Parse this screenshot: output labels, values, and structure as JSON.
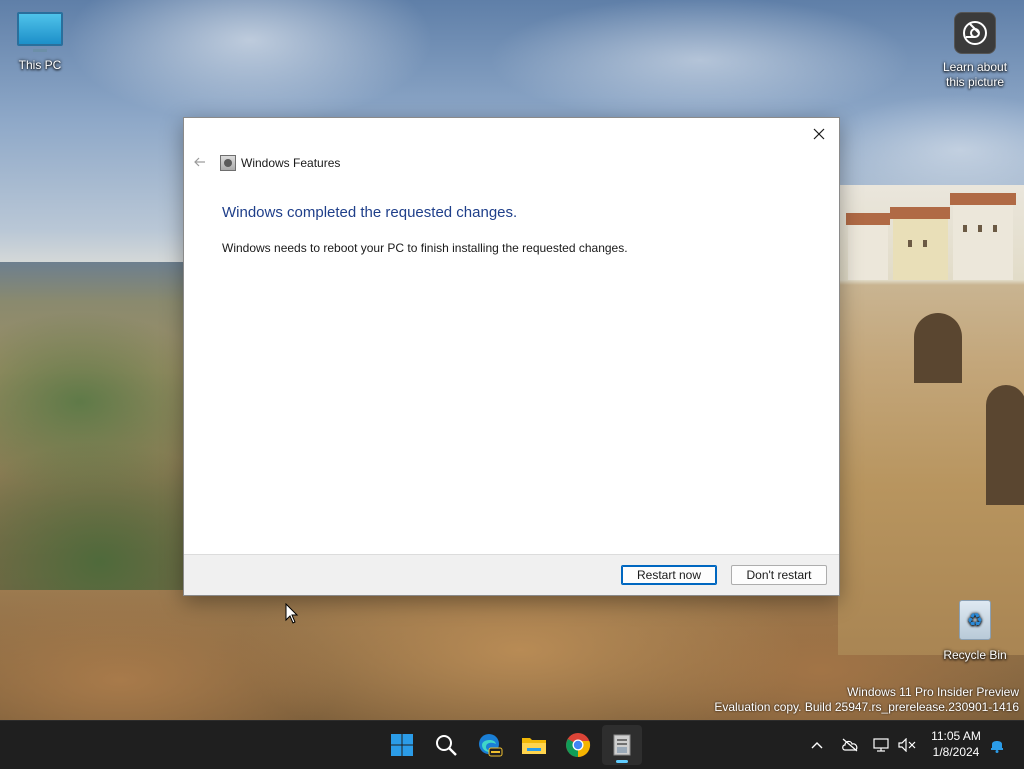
{
  "desktop": {
    "icons": {
      "this_pc": "This PC",
      "learn_line1": "Learn about",
      "learn_line2": "this picture",
      "recycle_bin": "Recycle Bin"
    },
    "watermark": {
      "line1": "Windows 11 Pro Insider Preview",
      "line2": "Evaluation copy. Build 25947.rs_prerelease.230901-1416"
    }
  },
  "dialog": {
    "title": "Windows Features",
    "heading": "Windows completed the requested changes.",
    "message": "Windows needs to reboot your PC to finish installing the requested changes.",
    "buttons": {
      "restart": "Restart now",
      "dont_restart": "Don't restart"
    }
  },
  "taskbar": {
    "apps": [
      "start-icon",
      "search-icon",
      "edge-beta-icon",
      "file-explorer-icon",
      "chrome-icon",
      "windows-features-icon"
    ],
    "active_app": "windows-features-icon",
    "clock": {
      "time": "11:05 AM",
      "date": "1/8/2024"
    }
  },
  "colors": {
    "heading": "#1f3f8a",
    "taskbar": "#1f1f1f",
    "accent": "#0067c0",
    "active_indicator": "#60cdff"
  }
}
